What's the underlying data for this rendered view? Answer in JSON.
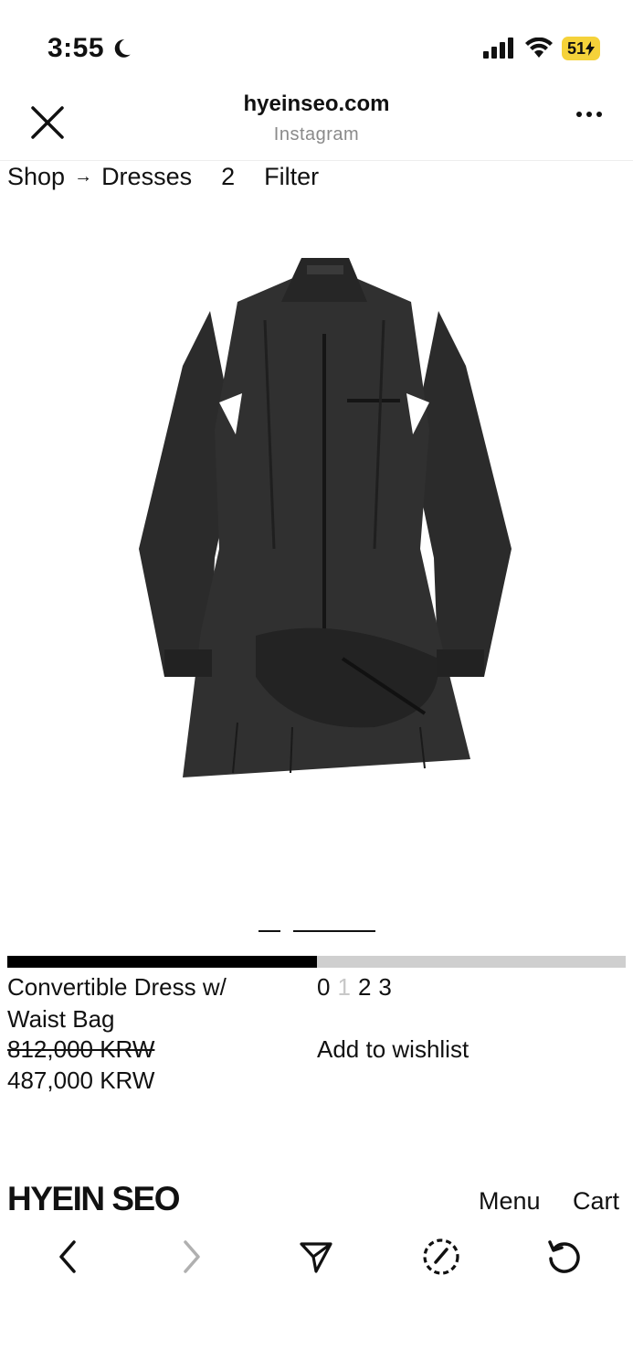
{
  "status_bar": {
    "time": "3:55",
    "battery": "51"
  },
  "browser": {
    "domain": "hyeinseo.com",
    "source": "Instagram"
  },
  "breadcrumb": {
    "shop": "Shop",
    "arrow": "→",
    "category": "Dresses",
    "count": "2",
    "filter": "Filter"
  },
  "product": {
    "name": "Convertible Dress w/ Waist Bag",
    "original_price": "812,000 KRW",
    "sale_price": "487,000 KRW",
    "image_progress": 0.5,
    "sizes": [
      {
        "label": "0",
        "available": true
      },
      {
        "label": "1",
        "available": false
      },
      {
        "label": "2",
        "available": true
      },
      {
        "label": "3",
        "available": true
      }
    ],
    "wishlist_label": "Add to wishlist"
  },
  "footer": {
    "brand": "HYEIN SEO",
    "menu": "Menu",
    "cart": "Cart"
  },
  "toolbar": {
    "icons": [
      "back-icon",
      "forward-icon",
      "share-icon",
      "compass-icon",
      "reload-icon"
    ]
  },
  "colors": {
    "battery": "#f5d23a",
    "progress_fill": "#000000",
    "progress_track": "#cfcfcf",
    "unavailable_size": "#c8c8c8"
  }
}
